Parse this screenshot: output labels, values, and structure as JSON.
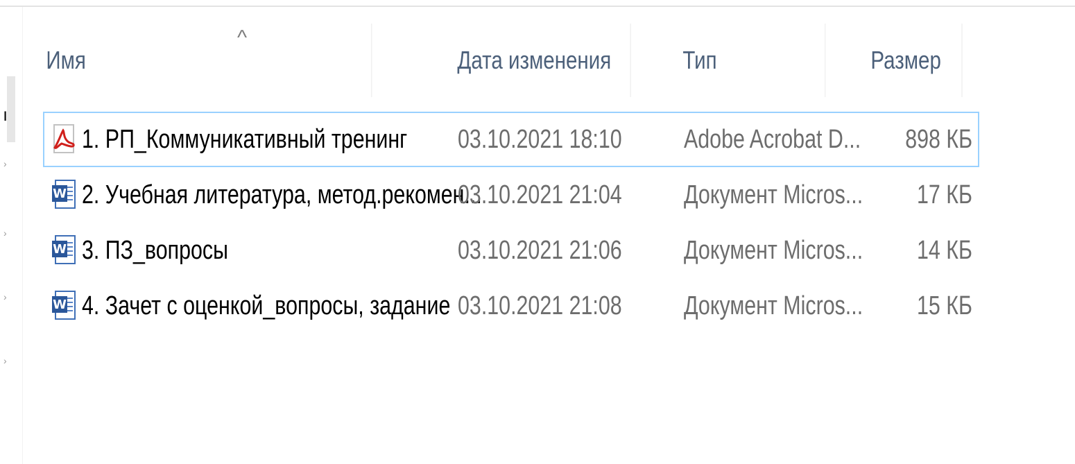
{
  "left_pane": {
    "char": "ı"
  },
  "columns": {
    "name": "Имя",
    "date": "Дата изменения",
    "type": "Тип",
    "size": "Размер"
  },
  "sort": {
    "column": "name",
    "icon": "chevron-up-icon",
    "glyph": "^"
  },
  "files": [
    {
      "icon": "pdf-icon",
      "name": "1. РП_Коммуникативный тренинг",
      "date": "03.10.2021 18:10",
      "type": "Adobe Acrobat D...",
      "size": "898 КБ",
      "selected": true
    },
    {
      "icon": "word-icon",
      "name": "2. Учебная литература, метод.рекомен...",
      "date": "03.10.2021 21:04",
      "type": "Документ Micros...",
      "size": "17 КБ",
      "selected": false
    },
    {
      "icon": "word-icon",
      "name": "3. ПЗ_вопросы",
      "date": "03.10.2021 21:06",
      "type": "Документ Micros...",
      "size": "14 КБ",
      "selected": false
    },
    {
      "icon": "word-icon",
      "name": "4. Зачет с оценкой_вопросы, задание",
      "date": "03.10.2021 21:08",
      "type": "Документ Micros...",
      "size": "15 КБ",
      "selected": false
    }
  ],
  "colors": {
    "header_text": "#4c607a",
    "selection_border": "#99d1ff",
    "secondary_text": "#6d6d6d",
    "pdf_red": "#d0201c",
    "word_blue": "#2b579a"
  }
}
